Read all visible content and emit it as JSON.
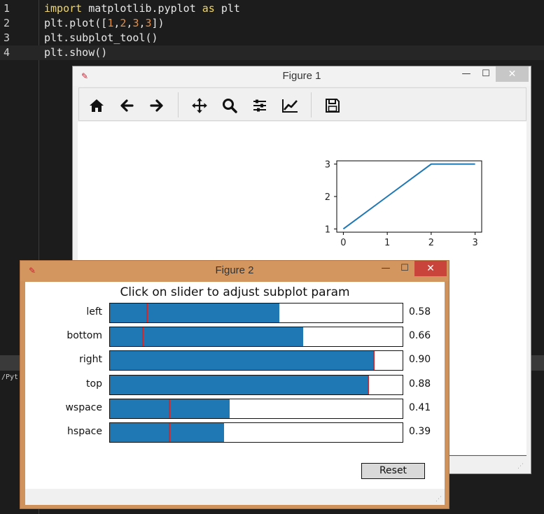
{
  "editor": {
    "lines": [
      {
        "num": "1",
        "parts": [
          {
            "t": "import",
            "c": "kw"
          },
          {
            "t": " matplotlib.pyplot ",
            "c": ""
          },
          {
            "t": "as",
            "c": "kw"
          },
          {
            "t": " plt",
            "c": ""
          }
        ]
      },
      {
        "num": "2",
        "parts": [
          {
            "t": "plt.plot([",
            "c": ""
          },
          {
            "t": "1",
            "c": "num"
          },
          {
            "t": ",",
            "c": ""
          },
          {
            "t": "2",
            "c": "num"
          },
          {
            "t": ",",
            "c": ""
          },
          {
            "t": "3",
            "c": "num"
          },
          {
            "t": ",",
            "c": ""
          },
          {
            "t": "3",
            "c": "num"
          },
          {
            "t": "])",
            "c": ""
          }
        ]
      },
      {
        "num": "3",
        "parts": [
          {
            "t": "plt.subplot_tool()",
            "c": ""
          }
        ]
      },
      {
        "num": "4",
        "parts": [
          {
            "t": "plt.show()",
            "c": ""
          }
        ]
      }
    ],
    "terminal_text": "/Pyt"
  },
  "figure1": {
    "title": "Figure 1",
    "window_controls": {
      "minimize": "—",
      "maximize": "☐",
      "close": "✕"
    },
    "toolbar": [
      {
        "name": "home-icon",
        "group": 0
      },
      {
        "name": "back-arrow-icon",
        "group": 0
      },
      {
        "name": "forward-arrow-icon",
        "group": 0
      },
      {
        "name": "pan-move-icon",
        "group": 1
      },
      {
        "name": "zoom-magnifier-icon",
        "group": 1
      },
      {
        "name": "configure-subplots-icon",
        "group": 1
      },
      {
        "name": "edit-axis-curves-icon",
        "group": 1
      },
      {
        "name": "save-figure-icon",
        "group": 2
      }
    ],
    "chart_data": {
      "type": "line",
      "x": [
        0,
        1,
        2,
        3
      ],
      "series": [
        {
          "values": [
            1,
            2,
            3,
            3
          ],
          "color": "#1f77b4"
        }
      ],
      "xticks": [
        "0",
        "1",
        "2",
        "3"
      ],
      "yticks": [
        "1",
        "2",
        "3"
      ],
      "xlim": [
        -0.15,
        3.15
      ],
      "ylim": [
        0.9,
        3.1
      ],
      "title": "",
      "xlabel": "",
      "ylabel": "",
      "grid": false
    }
  },
  "figure2": {
    "title": "Figure 2",
    "window_controls": {
      "minimize": "—",
      "maximize": "☐",
      "close": "✕"
    },
    "heading": "Click on slider to adjust subplot param",
    "sliders": [
      {
        "label": "left",
        "value": 0.58,
        "value_text": "0.58",
        "initial": 0.125
      },
      {
        "label": "bottom",
        "value": 0.66,
        "value_text": "0.66",
        "initial": 0.11
      },
      {
        "label": "right",
        "value": 0.9,
        "value_text": "0.90",
        "initial": 0.9
      },
      {
        "label": "top",
        "value": 0.88,
        "value_text": "0.88",
        "initial": 0.88
      },
      {
        "label": "wspace",
        "value": 0.41,
        "value_text": "0.41",
        "initial": 0.2
      },
      {
        "label": "hspace",
        "value": 0.39,
        "value_text": "0.39",
        "initial": 0.2
      }
    ],
    "reset_label": "Reset"
  },
  "colors": {
    "slider_fill": "#1f77b4",
    "slider_initial": "#d62728",
    "figure2_frame": "#d0925c",
    "close_active": "#c9443a"
  }
}
